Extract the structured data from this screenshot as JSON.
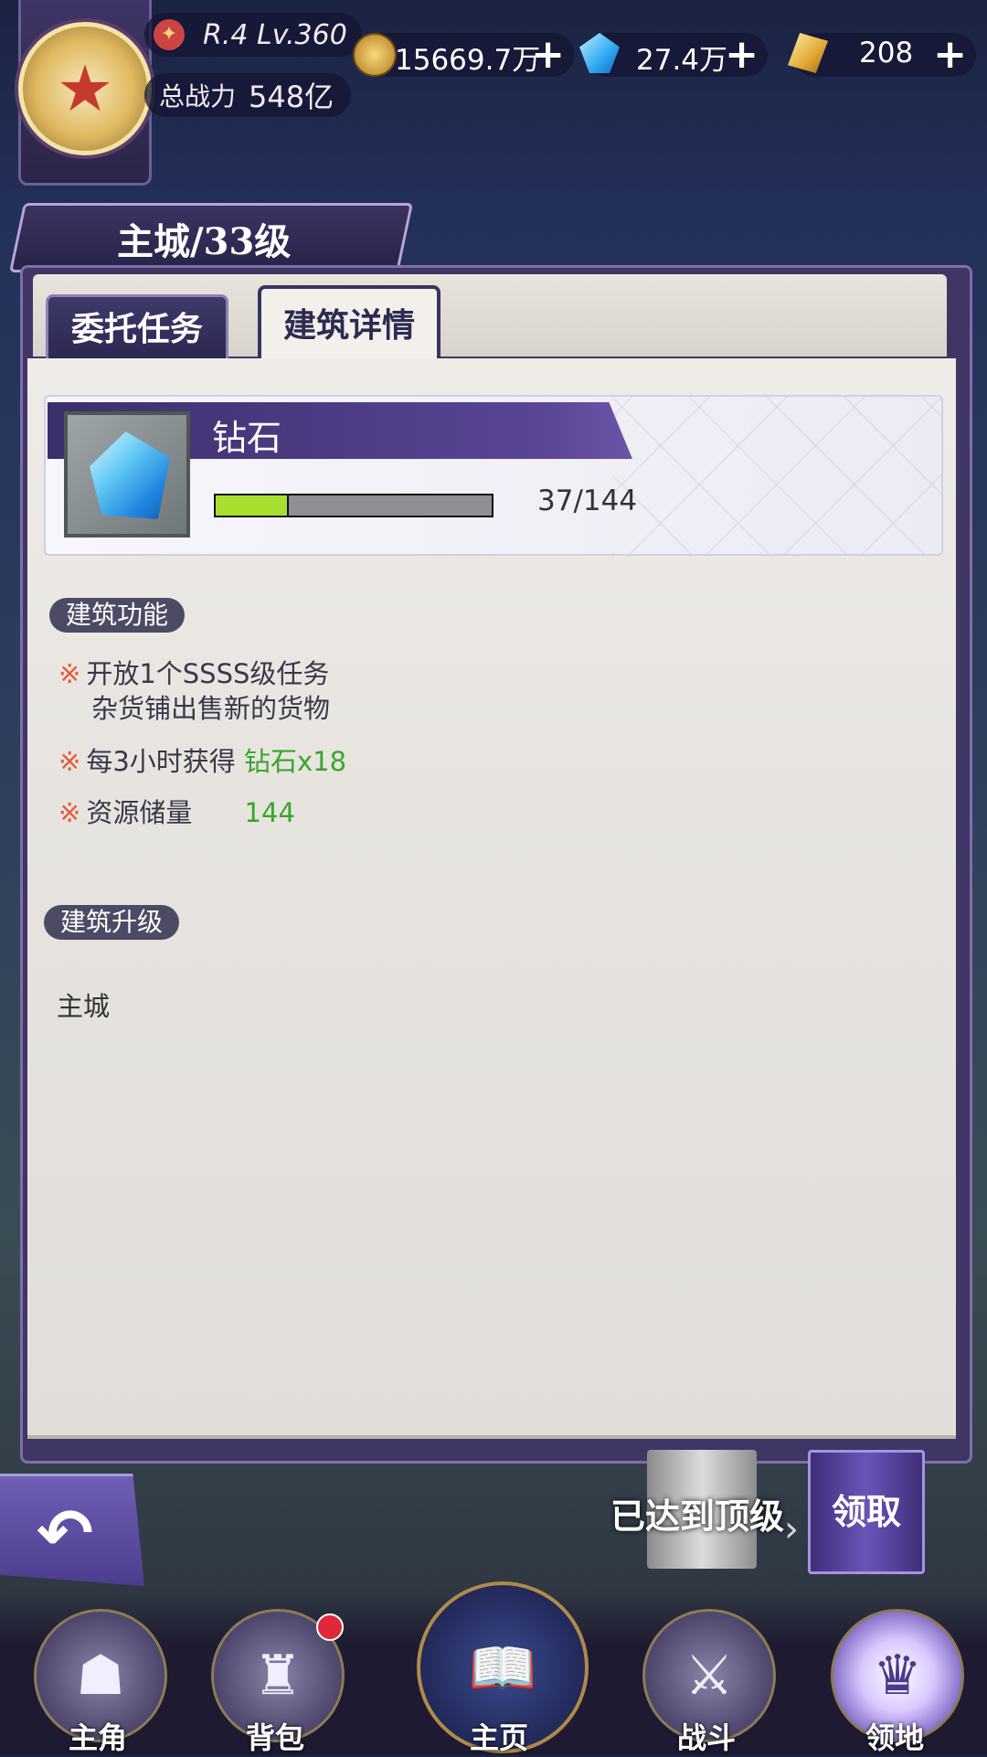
{
  "header": {
    "rank_level": "R.4 Lv.360",
    "power_label": "总战力",
    "power_value": "548亿",
    "currencies": [
      {
        "icon": "coin-icon",
        "value": "15669.7万"
      },
      {
        "icon": "diamond-icon",
        "value": "27.4万"
      },
      {
        "icon": "gold-nugget-icon",
        "value": "208"
      }
    ]
  },
  "title": {
    "building": "主城",
    "level": "/33级"
  },
  "tabs": [
    {
      "label": "委托任务",
      "active": false
    },
    {
      "label": "建筑详情",
      "active": true
    }
  ],
  "item": {
    "name": "钻石",
    "current": 37,
    "max": 144,
    "count_text": "37/144",
    "bar_color": "#a8de2e"
  },
  "functions": {
    "tag": "建筑功能",
    "line1": "开放1个SSSS级任务",
    "line1b": "杂货铺出售新的货物",
    "line2_prefix": "每3小时获得",
    "line2_highlight": "钻石x18",
    "line3_label": "资源储量",
    "line3_value": "144",
    "marker": "※"
  },
  "upgrade": {
    "tag": "建筑升级",
    "building": "主城"
  },
  "actions": {
    "maxed": "已达到顶级",
    "claim": "领取"
  },
  "nav": [
    {
      "label": "主角",
      "icon": "hooded-hero-icon"
    },
    {
      "label": "背包",
      "icon": "bag-icon",
      "badge": true
    },
    {
      "label": "主页",
      "icon": "book-icon"
    },
    {
      "label": "战斗",
      "icon": "crossed-swords-icon"
    },
    {
      "label": "领地",
      "icon": "crystal-castle-icon"
    }
  ]
}
